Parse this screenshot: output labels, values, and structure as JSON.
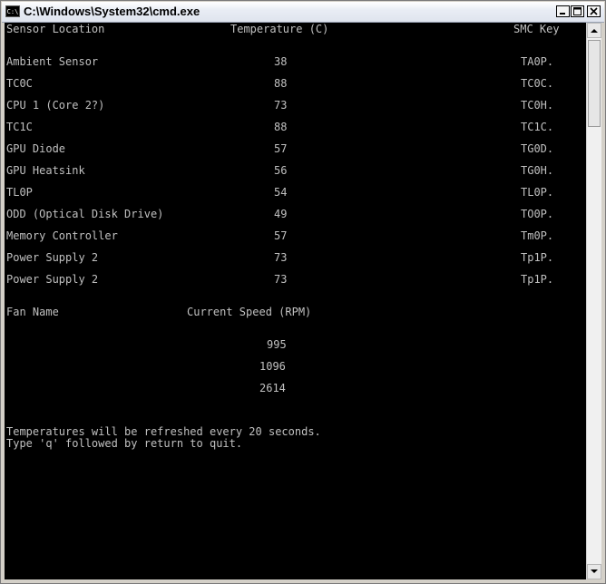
{
  "window": {
    "title": "C:\\Windows\\System32\\cmd.exe",
    "icon_label": "C:\\"
  },
  "console": {
    "sensor_headers": {
      "location": "Sensor Location",
      "temperature": "Temperature (C)",
      "smc_key": "SMC Key"
    },
    "sensors": [
      {
        "location": "Ambient Sensor",
        "temp": "38",
        "key": "TA0P."
      },
      {
        "location": "TC0C",
        "temp": "88",
        "key": "TC0C."
      },
      {
        "location": "CPU 1 (Core 2?)",
        "temp": "73",
        "key": "TC0H."
      },
      {
        "location": "TC1C",
        "temp": "88",
        "key": "TC1C."
      },
      {
        "location": "GPU Diode",
        "temp": "57",
        "key": "TG0D."
      },
      {
        "location": "GPU Heatsink",
        "temp": "56",
        "key": "TG0H."
      },
      {
        "location": "TL0P",
        "temp": "54",
        "key": "TL0P."
      },
      {
        "location": "ODD (Optical Disk Drive)",
        "temp": "49",
        "key": "TO0P."
      },
      {
        "location": "Memory Controller",
        "temp": "57",
        "key": "Tm0P."
      },
      {
        "location": "Power Supply 2",
        "temp": "73",
        "key": "Tp1P."
      },
      {
        "location": "Power Supply 2",
        "temp": "73",
        "key": "Tp1P."
      }
    ],
    "fan_headers": {
      "name": "Fan Name",
      "speed": "Current Speed (RPM)"
    },
    "fan_speeds": [
      "995",
      "1096",
      "2614"
    ],
    "messages": [
      "Temperatures will be refreshed every 20 seconds.",
      "Type 'q' followed by return to quit."
    ]
  },
  "colors": {
    "console_bg": "#000000",
    "console_text": "#c0c0c0"
  },
  "icons": {
    "minimize": "minimize-icon",
    "maximize": "maximize-icon",
    "close": "close-icon"
  }
}
